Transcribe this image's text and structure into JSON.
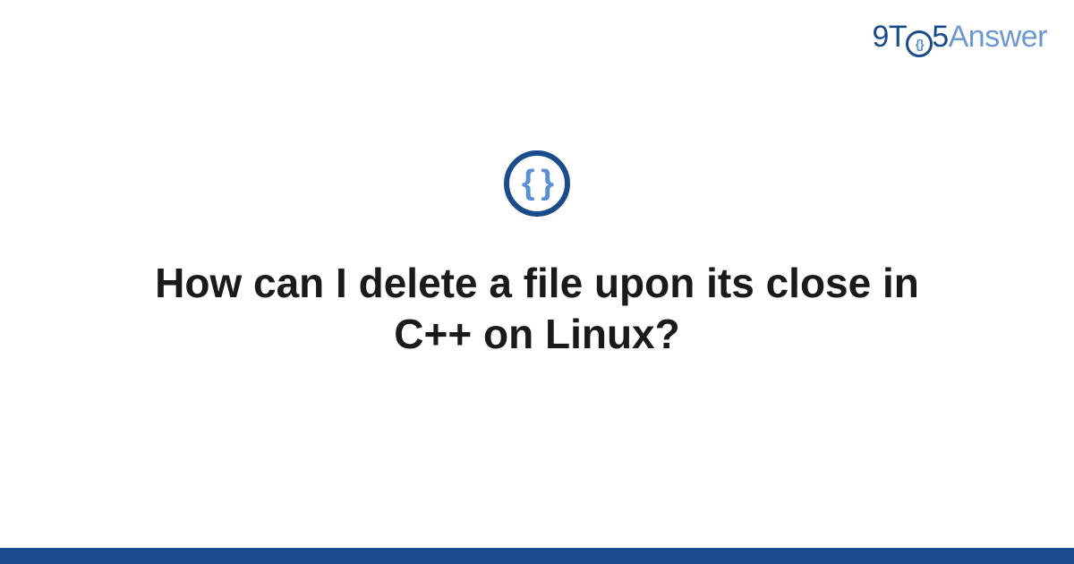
{
  "brand": {
    "part1": "9T",
    "part2": "5",
    "part3": "Answer"
  },
  "icon": {
    "glyph": "{ }"
  },
  "question": {
    "title": "How can I delete a file upon its close in C++ on Linux?"
  }
}
